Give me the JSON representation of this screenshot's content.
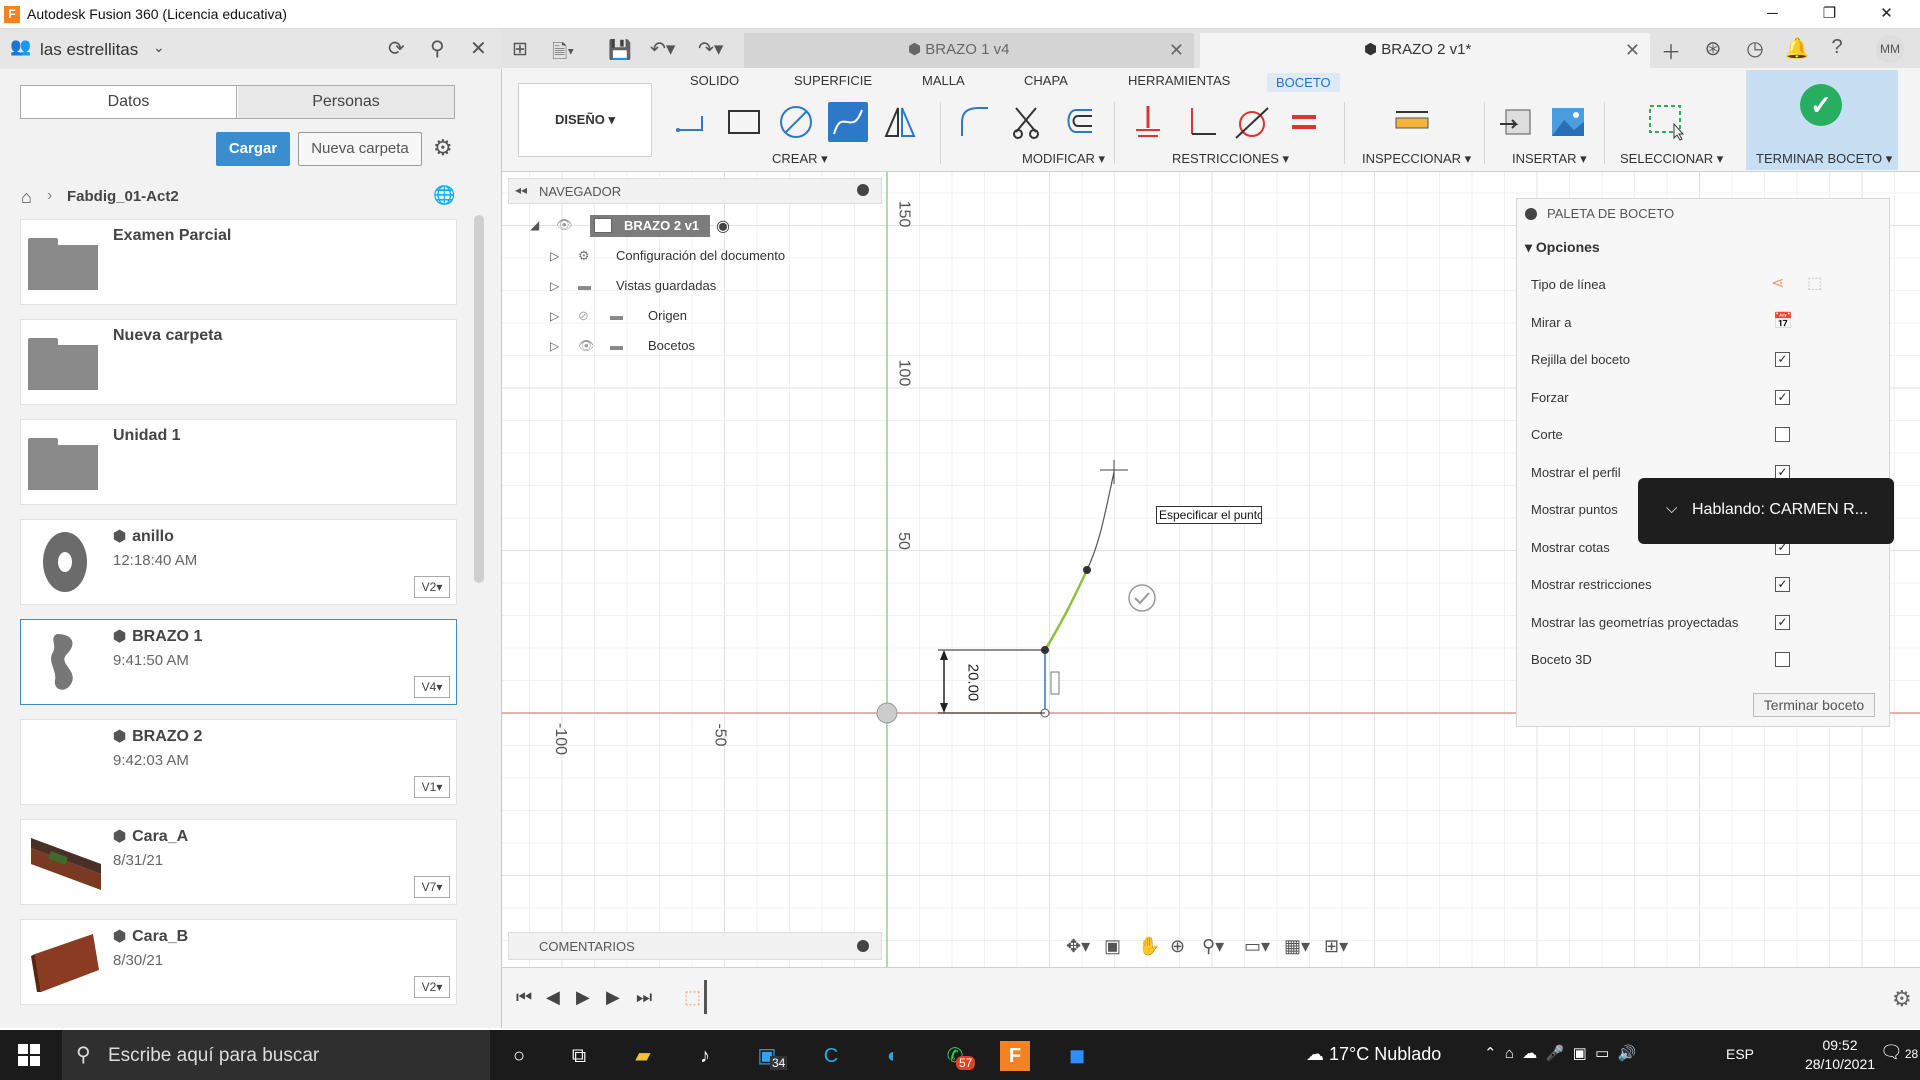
{
  "window": {
    "title": "Autodesk Fusion 360 (Licencia educativa)",
    "app_icon_letter": "F",
    "minimize": "─",
    "restore": "❐",
    "close": "✕"
  },
  "left_panel": {
    "team_name": "las estrellitas",
    "tabs": {
      "datos": "Datos",
      "personas": "Personas"
    },
    "cargar": "Cargar",
    "nueva_carpeta": "Nueva carpeta",
    "project": "Fabdig_01-Act2",
    "items": [
      {
        "name": "Examen Parcial",
        "kind": "folder"
      },
      {
        "name": "Nueva carpeta",
        "kind": "folder"
      },
      {
        "name": "Unidad 1",
        "kind": "folder"
      },
      {
        "name": "anillo",
        "date": "12:18:40 AM",
        "version": "V2▾"
      },
      {
        "name": "BRAZO 1",
        "date": "9:41:50 AM",
        "version": "V4▾"
      },
      {
        "name": "BRAZO 2",
        "date": "9:42:03 AM",
        "version": "V1▾"
      },
      {
        "name": "Cara_A",
        "date": "8/31/21",
        "version": "V7▾"
      },
      {
        "name": "Cara_B",
        "date": "8/30/21",
        "version": "V2▾"
      }
    ]
  },
  "doc_tabs": [
    {
      "name": "BRAZO 1 v4",
      "close": "✕"
    },
    {
      "name": "BRAZO 2 v1*",
      "close": "✕"
    }
  ],
  "user_initials": "MM",
  "ribbon": {
    "workspace": "DISEÑO ▾",
    "tabs": [
      "SOLIDO",
      "SUPERFICIE",
      "MALLA",
      "CHAPA",
      "HERRAMIENTAS",
      "BOCETO"
    ],
    "groups": {
      "crear": "CREAR ▾",
      "modificar": "MODIFICAR ▾",
      "restricciones": "RESTRICCIONES ▾",
      "inspeccionar": "INSPECCIONAR ▾",
      "insertar": "INSERTAR ▾",
      "seleccionar": "SELECCIONAR ▾",
      "terminar": "TERMINAR BOCETO ▾"
    }
  },
  "navigator": {
    "title": "NAVEGADOR",
    "root": "BRAZO 2 v1",
    "nodes": [
      "Configuración del documento",
      "Vistas guardadas",
      "Origen",
      "Bocetos"
    ]
  },
  "comments_title": "COMENTARIOS",
  "viewport": {
    "axis_labels": [
      "150",
      "100",
      "50",
      "-100",
      "-50"
    ],
    "dimension": "20.00",
    "tooltip": "Especificar el punto"
  },
  "palette": {
    "title": "PALETA DE BOCETO",
    "section": "Opciones",
    "rows": [
      {
        "label": "Tipo de línea",
        "control": "icons"
      },
      {
        "label": "Mirar a",
        "control": "icon"
      },
      {
        "label": "Rejilla del boceto",
        "checked": true
      },
      {
        "label": "Forzar",
        "checked": true
      },
      {
        "label": "Corte",
        "checked": false
      },
      {
        "label": "Mostrar el perfil",
        "checked": true
      },
      {
        "label": "Mostrar puntos",
        "checked": true
      },
      {
        "label": "Mostrar cotas",
        "checked": true
      },
      {
        "label": "Mostrar restricciones",
        "checked": true
      },
      {
        "label": "Mostrar las geometrías proyectadas",
        "checked": true
      },
      {
        "label": "Boceto 3D",
        "checked": false
      }
    ],
    "finish": "Terminar boceto"
  },
  "toast": {
    "text": "Hablando: CARMEN R..."
  },
  "taskbar": {
    "search": "Escribe aquí para buscar",
    "badges": {
      "store": "34",
      "whatsapp": "57"
    },
    "weather": "17°C Nublado",
    "lang": "ESP",
    "time": "09:52",
    "date": "28/10/2021",
    "notifications": "28"
  },
  "colors": {
    "accent": "#3c8dcd",
    "active_tool": "#2e79c7",
    "finish_green": "#27ae60",
    "x_axis": "#e88f8f",
    "y_axis": "#8fd08f"
  }
}
